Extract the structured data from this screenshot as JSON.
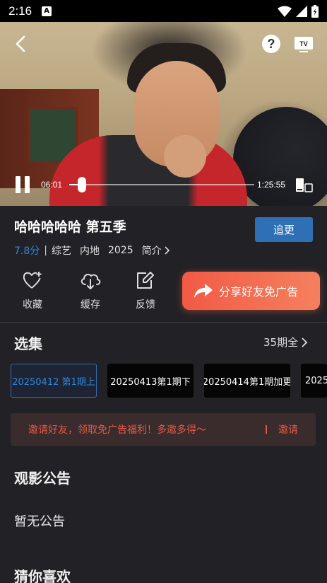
{
  "status_bar": {
    "time": "2:16",
    "notification_badge": "A"
  },
  "player": {
    "current_time": "06:01",
    "total_time": "1:25:55",
    "progress": 0.07
  },
  "show": {
    "title": "哈哈哈哈哈 第五季",
    "follow_label": "追更",
    "score": "7.8分",
    "meta_separator": "|",
    "category": "综艺",
    "region": "内地",
    "year": "2025",
    "intro_label": "简介"
  },
  "actions": {
    "favorite_label": "收藏",
    "cache_label": "缓存",
    "feedback_label": "反馈",
    "share_label": "分享好友免广告"
  },
  "episodes": {
    "section_title": "选集",
    "count_label": "35期全",
    "items": [
      {
        "label": "20250412 第1期上",
        "active": true
      },
      {
        "label": "20250413第1期下",
        "active": false
      },
      {
        "label": "20250414第1期加更",
        "active": false
      },
      {
        "label": "2025",
        "active": false
      }
    ]
  },
  "invite": {
    "message": "邀请好友，领取免广告福利！多邀多得～",
    "separator": "I",
    "link_label": "邀请"
  },
  "notice": {
    "section_title": "观影公告",
    "text": "暂无公告"
  },
  "recommend": {
    "section_title": "猜你喜欢"
  },
  "colors": {
    "accent_blue": "#2f6fb5",
    "score_blue": "#2f86d9",
    "share_red": "#f25a45",
    "background": "#222226"
  },
  "icons": {
    "back": "chevron-left-icon",
    "help": "question-icon",
    "tv": "tv-cast-icon",
    "pause": "pause-icon",
    "screen": "screen-icon",
    "favorite": "heart-plus-icon",
    "cache": "cloud-download-icon",
    "feedback": "edit-icon",
    "share": "share-arrow-icon",
    "chevron": "chevron-right-icon"
  }
}
